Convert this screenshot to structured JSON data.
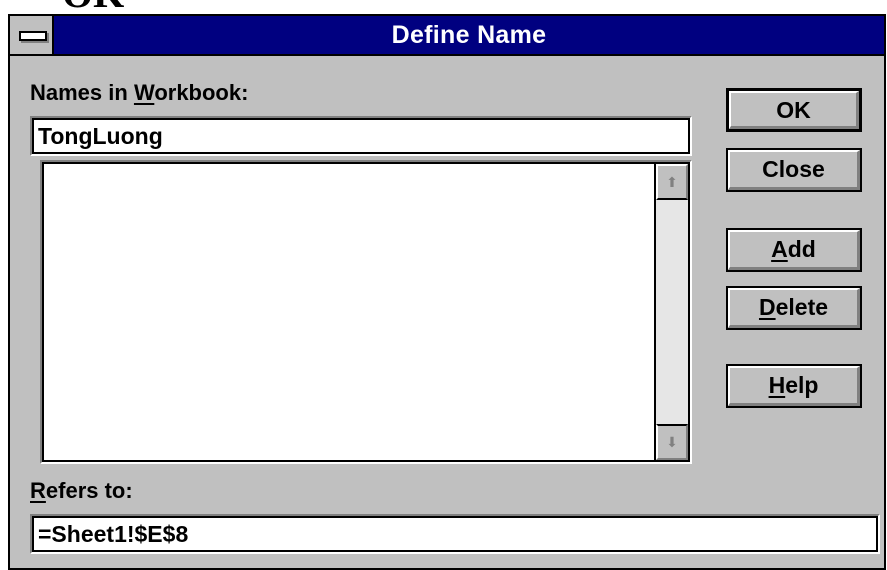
{
  "outer_caption": "OK",
  "dialog": {
    "title": "Define Name"
  },
  "names_label": {
    "underline_letter": "W",
    "before": "Names in ",
    "after": "orkbook:"
  },
  "name_input": {
    "value": "TongLuong"
  },
  "names_list": {
    "items": []
  },
  "refers_label": {
    "underline_letter": "R",
    "after": "efers to:"
  },
  "refers_input": {
    "value": "=Sheet1!$E$8"
  },
  "buttons": {
    "ok": "OK",
    "close": "Close",
    "add": {
      "mnemonic": "A",
      "rest": "dd"
    },
    "delete": {
      "mnemonic": "D",
      "rest": "elete"
    },
    "help": {
      "mnemonic": "H",
      "rest": "elp"
    }
  },
  "icons": {
    "scroll_up": "scroll-up-arrow-icon",
    "scroll_down": "scroll-down-arrow-icon",
    "system_menu": "system-menu-icon"
  }
}
